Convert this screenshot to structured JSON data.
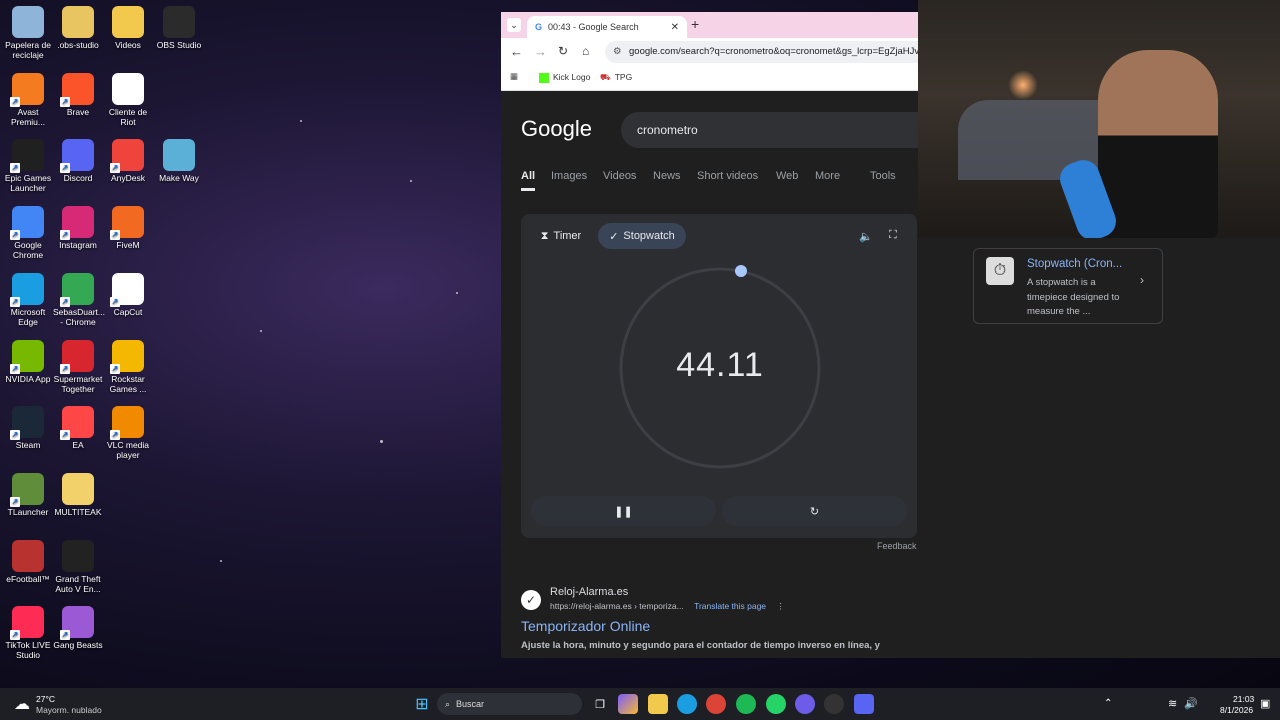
{
  "desktop_icons": [
    {
      "label": "Papelera de reciclaje",
      "icon": "recycle-bin-icon",
      "color": "#8fb4d9"
    },
    {
      "label": ".obs-studio",
      "icon": "folder-icon",
      "color": "#e8c560"
    },
    {
      "label": "Videos",
      "icon": "folder-icon",
      "color": "#f2c94c"
    },
    {
      "label": "OBS Studio",
      "icon": "obs-icon",
      "color": "#2b2b2b"
    },
    {
      "label": "Avast Premiu...",
      "icon": "avast-icon",
      "color": "#f47b20"
    },
    {
      "label": "Brave",
      "icon": "brave-icon",
      "color": "#fb542b"
    },
    {
      "label": "Cliente de Riot",
      "icon": "file-icon",
      "color": "#ffffff"
    },
    {
      "label": "Epic Games Launcher",
      "icon": "epic-icon",
      "color": "#202020"
    },
    {
      "label": "Discord",
      "icon": "discord-icon",
      "color": "#5865f2"
    },
    {
      "label": "AnyDesk",
      "icon": "anydesk-icon",
      "color": "#ef443b"
    },
    {
      "label": "Make Way",
      "icon": "makeway-icon",
      "color": "#5bb0d8"
    },
    {
      "label": "Google Chrome",
      "icon": "chrome-icon",
      "color": "#4285f4"
    },
    {
      "label": "Instagram",
      "icon": "instagram-icon",
      "color": "#d62976"
    },
    {
      "label": "FiveM",
      "icon": "fivem-icon",
      "color": "#f26a21"
    },
    {
      "label": "Microsoft Edge",
      "icon": "edge-icon",
      "color": "#1b9de2"
    },
    {
      "label": "SebasDuart... - Chrome",
      "icon": "chrome-icon",
      "color": "#34a853"
    },
    {
      "label": "CapCut",
      "icon": "capcut-icon",
      "color": "#ffffff"
    },
    {
      "label": "NVIDIA App",
      "icon": "nvidia-icon",
      "color": "#76b900"
    },
    {
      "label": "Supermarket Together",
      "icon": "supermarket-icon",
      "color": "#d7262d"
    },
    {
      "label": "Rockstar Games ...",
      "icon": "rockstar-icon",
      "color": "#f5b800"
    },
    {
      "label": "Steam",
      "icon": "steam-icon",
      "color": "#1b2838"
    },
    {
      "label": "EA",
      "icon": "ea-icon",
      "color": "#ff4747"
    },
    {
      "label": "VLC media player",
      "icon": "vlc-icon",
      "color": "#f28a00"
    },
    {
      "label": "TLauncher",
      "icon": "tlauncher-icon",
      "color": "#5f8d3a"
    },
    {
      "label": "MULTITEAK",
      "icon": "folder-icon",
      "color": "#f2d16b"
    },
    {
      "label": "eFootball™",
      "icon": "efootball-icon",
      "color": "#b8332f"
    },
    {
      "label": "Grand Theft Auto V En...",
      "icon": "gta-icon",
      "color": "#222222"
    },
    {
      "label": "TikTok LIVE Studio",
      "icon": "tiktok-icon",
      "color": "#fe2c55"
    },
    {
      "label": "Gang Beasts",
      "icon": "gangbeasts-icon",
      "color": "#9b59d6"
    }
  ],
  "browser": {
    "tab_title": "00:43 - Google Search",
    "url": "google.com/search?q=cronometro&oq=cronomet&gs_lcrp=EgZjaHJv",
    "bookmarks": [
      "Kick Logo",
      "TPG"
    ],
    "new_tab": "+"
  },
  "google": {
    "logo": "Google",
    "query": "cronometro",
    "tabs": [
      "All",
      "Images",
      "Videos",
      "News",
      "Short videos",
      "Web",
      "More",
      "Tools"
    ],
    "active_tab": "All"
  },
  "stopwatch": {
    "timer_label": "Timer",
    "stopwatch_label": "Stopwatch",
    "time": "44.11",
    "feedback": "Feedback"
  },
  "result": {
    "site": "Reloj-Alarma.es",
    "url": "https://reloj-alarma.es › temporiza...",
    "translate": "Translate this page",
    "title": "Temporizador Online",
    "snippet": "Ajuste la hora, minuto y segundo para el contador de tiempo inverso en línea, y"
  },
  "knowledge": {
    "title": "Stopwatch (Cron...",
    "text": "A stopwatch is a timepiece designed to measure the ..."
  },
  "taskbar": {
    "weather_temp": "27°C",
    "weather_desc": "Mayorm. nublado",
    "search": "Buscar",
    "time": "21:03",
    "date": "8/1/2026"
  }
}
